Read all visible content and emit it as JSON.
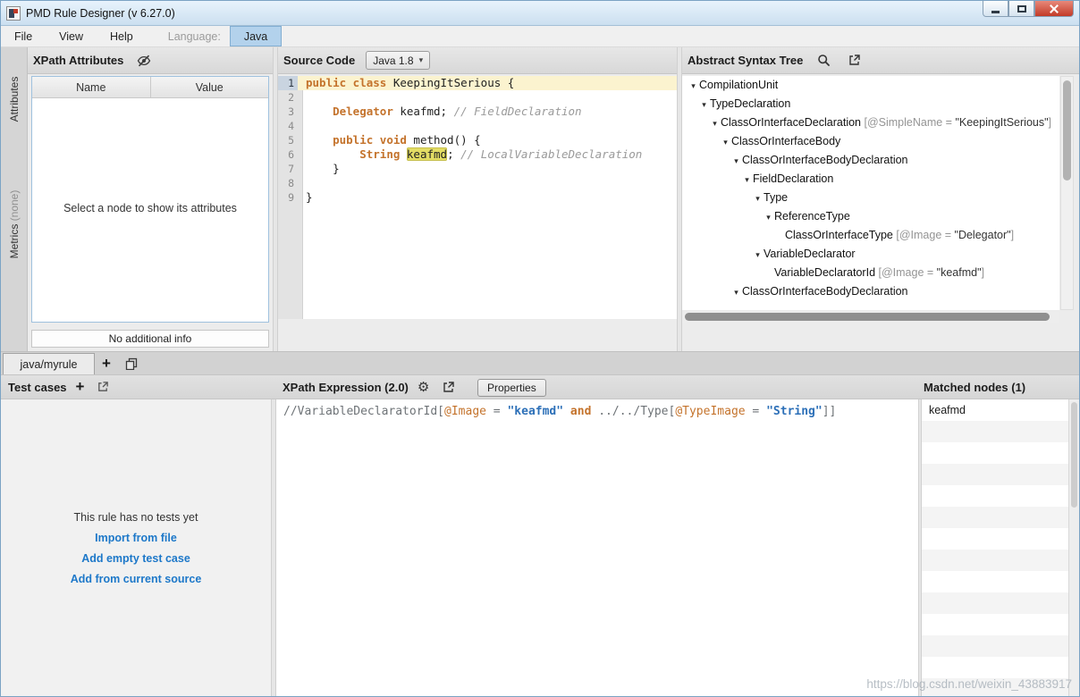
{
  "window": {
    "title": "PMD Rule Designer (v 6.27.0)"
  },
  "watermark": "https://blog.csdn.net/weixin_43883917",
  "icons": {
    "expand_arrow": "▾",
    "collapse_arrow": "▸",
    "plus": "+",
    "gear": "⚙",
    "combo_arrow": "▾"
  },
  "menu": {
    "items": [
      "File",
      "View",
      "Help"
    ],
    "language_label": "Language:",
    "language_selected": "Java"
  },
  "sidebar": {
    "attributes_label": "Attributes",
    "metrics_label": "Metrics",
    "metrics_suffix": "(none)"
  },
  "attributes_panel": {
    "title": "XPath Attributes",
    "columns": [
      "Name",
      "Value"
    ],
    "placeholder": "Select a node to show its attributes",
    "footer": "No additional info"
  },
  "source_panel": {
    "title": "Source Code",
    "language_version": "Java 1.8",
    "lines": [
      {
        "num": 1,
        "highlight": true,
        "tokens": [
          {
            "t": "public class ",
            "c": "kw"
          },
          {
            "t": "KeepingItSerious",
            "c": "plain"
          },
          {
            "t": " {",
            "c": "plain"
          }
        ]
      },
      {
        "num": 2,
        "tokens": []
      },
      {
        "num": 3,
        "tokens": [
          {
            "t": "    ",
            "c": "plain"
          },
          {
            "t": "Delegator",
            "c": "kw"
          },
          {
            "t": " keafmd; ",
            "c": "plain"
          },
          {
            "t": "// FieldDeclaration",
            "c": "comment"
          }
        ]
      },
      {
        "num": 4,
        "tokens": []
      },
      {
        "num": 5,
        "tokens": [
          {
            "t": "    ",
            "c": "plain"
          },
          {
            "t": "public void",
            "c": "kw"
          },
          {
            "t": " method() {",
            "c": "plain"
          }
        ]
      },
      {
        "num": 6,
        "tokens": [
          {
            "t": "        ",
            "c": "plain"
          },
          {
            "t": "String",
            "c": "kw"
          },
          {
            "t": " ",
            "c": "plain"
          },
          {
            "t": "keafmd",
            "c": "mark"
          },
          {
            "t": "; ",
            "c": "plain"
          },
          {
            "t": "// LocalVariableDeclaration",
            "c": "comment"
          }
        ]
      },
      {
        "num": 7,
        "tokens": [
          {
            "t": "    }",
            "c": "plain"
          }
        ]
      },
      {
        "num": 8,
        "tokens": []
      },
      {
        "num": 9,
        "tokens": [
          {
            "t": "}",
            "c": "plain"
          }
        ]
      }
    ]
  },
  "ast_panel": {
    "title": "Abstract Syntax Tree",
    "nodes": [
      {
        "level": 0,
        "name": "CompilationUnit"
      },
      {
        "level": 1,
        "name": "TypeDeclaration"
      },
      {
        "level": 2,
        "name": "ClassOrInterfaceDeclaration",
        "attr_name": "@SimpleName",
        "attr_value": "\"KeepingItSerious\""
      },
      {
        "level": 3,
        "name": "ClassOrInterfaceBody"
      },
      {
        "level": 4,
        "name": "ClassOrInterfaceBodyDeclaration"
      },
      {
        "level": 5,
        "name": "FieldDeclaration"
      },
      {
        "level": 6,
        "name": "Type"
      },
      {
        "level": 7,
        "name": "ReferenceType"
      },
      {
        "level": 8,
        "name": "ClassOrInterfaceType",
        "leaf": true,
        "attr_name": "@Image",
        "attr_value": "\"Delegator\""
      },
      {
        "level": 6,
        "name": "VariableDeclarator"
      },
      {
        "level": 7,
        "name": "VariableDeclaratorId",
        "leaf": true,
        "attr_name": "@Image",
        "attr_value": "\"keafmd\""
      },
      {
        "level": 4,
        "name": "ClassOrInterfaceBodyDeclaration"
      }
    ]
  },
  "rule_tab": {
    "label": "java/myrule"
  },
  "test_cases": {
    "title": "Test cases",
    "empty_text": "This rule has no tests yet",
    "links": [
      "Import from file",
      "Add empty test case",
      "Add from current source"
    ]
  },
  "xpath_panel": {
    "title": "XPath Expression (2.0)",
    "properties_label": "Properties",
    "tokens": [
      {
        "t": "//VariableDeclaratorId[",
        "c": "path"
      },
      {
        "t": "@Image",
        "c": "attr"
      },
      {
        "t": " = ",
        "c": "path"
      },
      {
        "t": "\"keafmd\"",
        "c": "str"
      },
      {
        "t": " and ",
        "c": "xkw"
      },
      {
        "t": "../../Type[",
        "c": "path"
      },
      {
        "t": "@TypeImage",
        "c": "attr"
      },
      {
        "t": " = ",
        "c": "path"
      },
      {
        "t": "\"String\"",
        "c": "str"
      },
      {
        "t": "]]",
        "c": "path"
      }
    ]
  },
  "matched_panel": {
    "title": "Matched nodes (1)",
    "items": [
      "keafmd"
    ]
  }
}
